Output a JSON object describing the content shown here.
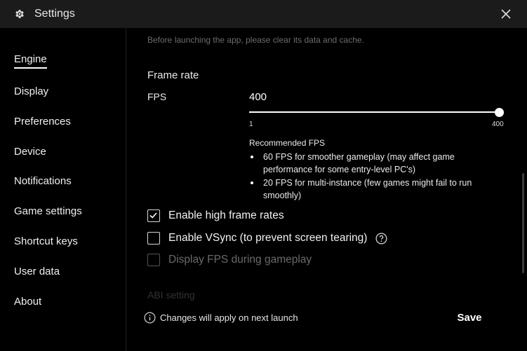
{
  "window": {
    "title": "Settings",
    "settings_icon": "gear-icon",
    "close_icon": "close-icon"
  },
  "sidebar": {
    "items": [
      {
        "label": "Engine",
        "active": true
      },
      {
        "label": "Display"
      },
      {
        "label": "Preferences"
      },
      {
        "label": "Device"
      },
      {
        "label": "Notifications"
      },
      {
        "label": "Game settings"
      },
      {
        "label": "Shortcut keys"
      },
      {
        "label": "User data"
      },
      {
        "label": "About"
      }
    ]
  },
  "main": {
    "top_hint": "Before launching the app, please clear its data and cache.",
    "frame_rate": {
      "title": "Frame rate",
      "fps_label": "FPS",
      "fps_value": "400",
      "slider": {
        "min_label": "1",
        "max_label": "400",
        "min": 1,
        "max": 400,
        "value": 400
      },
      "recommended_title": "Recommended FPS",
      "recommended": [
        "60 FPS for smoother gameplay (may affect game performance for some entry-level PC's)",
        "20 FPS for multi-instance (few games might fail to run smoothly)"
      ]
    },
    "options": [
      {
        "label": "Enable high frame rates",
        "checked": true,
        "disabled": false
      },
      {
        "label": "Enable VSync (to prevent screen tearing)",
        "checked": false,
        "disabled": false,
        "help_icon": "question-circle-icon"
      },
      {
        "label": "Display FPS during gameplay",
        "checked": false,
        "disabled": true
      }
    ],
    "next_section_partial": "ABI setting"
  },
  "footer": {
    "info_icon": "info-circle-icon",
    "note": "Changes will apply on next launch",
    "save_label": "Save"
  },
  "colors": {
    "background": "#000000",
    "titlebar": "#1b1b1b",
    "text": "#ffffff",
    "muted": "#6c6c6c"
  }
}
